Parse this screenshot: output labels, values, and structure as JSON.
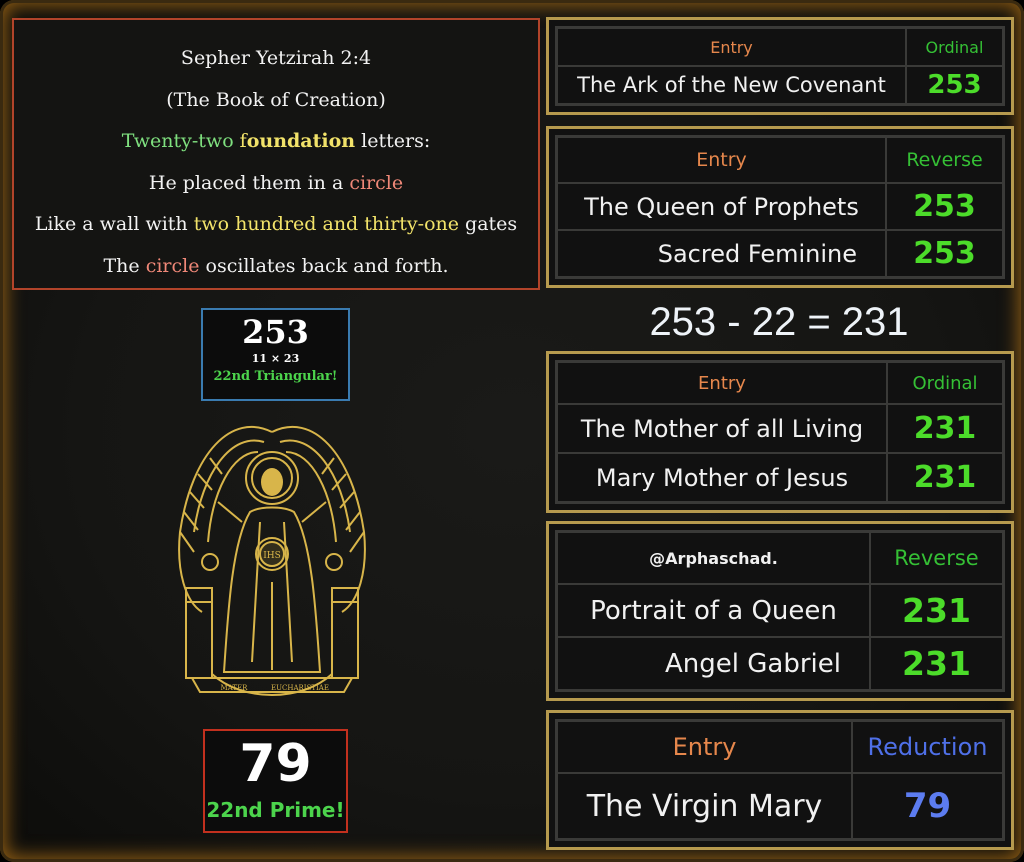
{
  "quote": {
    "line1": "Sepher Yetzirah 2:4",
    "line2": "(The Book of Creation)",
    "line3": {
      "a": "Twenty-two",
      "b": " f",
      "c": "oundation",
      "d": " letters:"
    },
    "line4": {
      "a": "He placed them in a ",
      "b": "circle"
    },
    "line5": {
      "a": "Like a wall with ",
      "b": "two hundred and thirty-one",
      "c": " gates"
    },
    "line6": {
      "a": "The ",
      "b": "circle",
      "c": " oscillates back and forth."
    }
  },
  "card_253": {
    "number": "253",
    "factors": "11 × 23",
    "note": "22nd Triangular!"
  },
  "emblem": {
    "inscription_left": "MATER",
    "inscription_right": "EUCHARISTIAE",
    "monogram": "IHS"
  },
  "card_79": {
    "number": "79",
    "note": "22nd Prime!"
  },
  "equation": "253 - 22 = 231",
  "tables": [
    {
      "header_entry": "Entry",
      "header_cipher": "Ordinal",
      "rows": [
        {
          "entry": "The Ark of the New Covenant",
          "value": "253"
        }
      ]
    },
    {
      "header_entry": "Entry",
      "header_cipher": "Reverse",
      "rows": [
        {
          "entry": "The Queen of Prophets",
          "value": "253"
        },
        {
          "entry": "Sacred Feminine",
          "value": "253"
        }
      ]
    },
    {
      "header_entry": "Entry",
      "header_cipher": "Ordinal",
      "rows": [
        {
          "entry": "The Mother of all Living",
          "value": "231"
        },
        {
          "entry": "Mary Mother of Jesus",
          "value": "231"
        }
      ]
    },
    {
      "header_entry": "@Arphaschad.",
      "header_cipher": "Reverse",
      "rows": [
        {
          "entry": "Portrait of a Queen",
          "value": "231"
        },
        {
          "entry": "Angel Gabriel",
          "value": "231"
        }
      ]
    },
    {
      "header_entry": "Entry",
      "header_cipher": "Reduction",
      "rows": [
        {
          "entry": "The Virgin Mary",
          "value": "79"
        }
      ]
    }
  ],
  "colors": {
    "frame_glow": "#8a5a14",
    "table_border": "#b69a4e",
    "value_green": "#4cdc2a",
    "header_orange": "#e6874c",
    "reduction_blue": "#4f70e8",
    "emblem_gold": "#d8b54a"
  }
}
